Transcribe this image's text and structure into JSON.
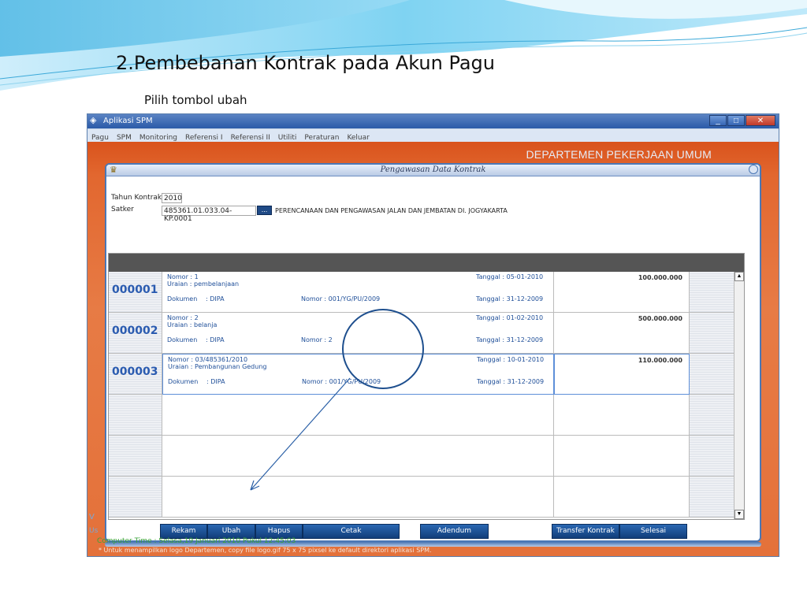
{
  "slide": {
    "title": "2.Pembebanan Kontrak pada Akun Pagu",
    "subtitle": "Pilih tombol ubah"
  },
  "window": {
    "title": "Aplikasi SPM",
    "minimize": "_",
    "maximize": "□",
    "close": "✕"
  },
  "menu": [
    "Pagu",
    "SPM",
    "Monitoring",
    "Referensi I",
    "Referensi II",
    "Utiliti",
    "Peraturan",
    "Keluar"
  ],
  "banner": {
    "department": "DEPARTEMEN PEKERJAAN UMUM"
  },
  "form": {
    "title": "Pengawasan Data Kontrak",
    "tahun_label": "Tahun Kontrak",
    "tahun_value": "2010",
    "satker_label": "Satker",
    "satker_code": "485361.01.033.04-KP.0001",
    "lookup_button": "...",
    "satker_name": "PERENCANAAN DAN PENGAWASAN JALAN DAN JEMBATAN DI. JOGYAKARTA"
  },
  "rows": [
    {
      "code": "000001",
      "nomor": "Nomor :  1",
      "uraian": "Uraian :  pembelanjaan",
      "dokumen_label": "Dokumen",
      "dokumen_value": ":  DIPA",
      "doc_nomor": "Nomor :  001/YG/PU/2009",
      "tanggal": "Tanggal : 05-01-2010",
      "tanggal_dok": "Tanggal : 31-12-2009",
      "amount": "100.000.000"
    },
    {
      "code": "000002",
      "nomor": "Nomor :  2",
      "uraian": "Uraian :  belanja",
      "dokumen_label": "Dokumen",
      "dokumen_value": ":  DIPA",
      "doc_nomor": "Nomor :  2",
      "tanggal": "Tanggal : 01-02-2010",
      "tanggal_dok": "Tanggal : 31-12-2009",
      "amount": "500.000.000"
    },
    {
      "code": "000003",
      "nomor": "Nomor :  03/485361/2010",
      "uraian": "Uraian :  Pembangunan Gedung",
      "dokumen_label": "Dokumen",
      "dokumen_value": ":  DIPA",
      "doc_nomor": "Nomor :  001/YG/PU/2009",
      "tanggal": "Tanggal : 10-01-2010",
      "tanggal_dok": "Tanggal : 31-12-2009",
      "amount": "110.000.000"
    }
  ],
  "buttons": {
    "rekam": "Rekam",
    "ubah": "Ubah",
    "hapus": "Hapus",
    "cetak": "Cetak",
    "adendum": "Adendum",
    "transfer": "Transfer Kontrak",
    "selesai": "Selesai"
  },
  "status": {
    "partial_v": "V",
    "partial_us": "Us",
    "computer_time": "Computer  Time : Selasa,19 Januari 2010 Pukul 12:45:03",
    "note": "* Untuk menampilkan logo Departemen, copy file logo.gif 75 x 75 pixsel ke default direktori aplikasi SPM."
  },
  "colors": {
    "accent_orange": "#e2672f",
    "frame_blue": "#4a77b5",
    "code_blue": "#2a5bb0",
    "button_blue": "#123e7a",
    "status_green": "#3aa33a"
  }
}
